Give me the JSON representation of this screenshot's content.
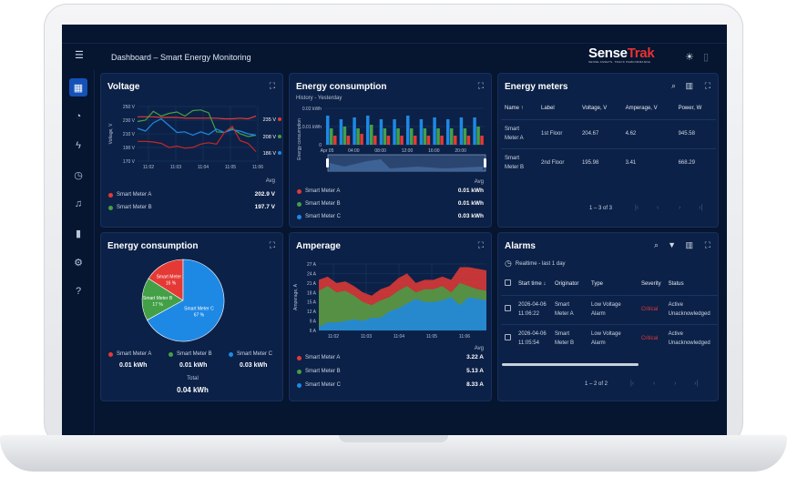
{
  "header": {
    "title": "Dashboard – Smart Energy Monitoring",
    "logo": {
      "part1": "Sense",
      "part2": "Trak",
      "tagline": "SENSE ASSETS. TRACK PERFORMANCE."
    }
  },
  "sidebar": {
    "items": [
      {
        "icon": "menu-icon",
        "glyph": "☰"
      },
      {
        "icon": "dashboard-icon",
        "glyph": "▦",
        "active": true
      },
      {
        "icon": "gauge-icon",
        "glyph": "◔"
      },
      {
        "icon": "bolt-icon",
        "glyph": "ϟ"
      },
      {
        "icon": "pie-icon",
        "glyph": "◷"
      },
      {
        "icon": "bell-icon",
        "glyph": "♫"
      },
      {
        "icon": "bar-chart-icon",
        "glyph": "▮"
      },
      {
        "icon": "settings-icon",
        "glyph": "⚙"
      },
      {
        "icon": "help-icon",
        "glyph": "?"
      }
    ]
  },
  "colors": {
    "a": "#e53935",
    "b": "#43a047",
    "c": "#1e88e5",
    "accent": "#1452b8",
    "bg": "#061530",
    "card": "#0c2147"
  },
  "voltage": {
    "title": "Voltage",
    "avg_label": "Avg",
    "chart_data": {
      "type": "line",
      "ylabel": "Voltage, V",
      "ylim": [
        170,
        250
      ],
      "yticks": [
        "250 V",
        "230 V",
        "210 V",
        "190 V",
        "170 V"
      ],
      "xticks": [
        "11:02",
        "11:03",
        "11:04",
        "11:05",
        "11:06"
      ],
      "series": [
        {
          "color": "#e53935",
          "values": [
            235,
            235,
            235,
            234,
            234,
            234,
            233,
            233,
            233,
            233,
            233,
            232,
            232,
            233,
            232,
            236
          ]
        },
        {
          "color": "#43a047",
          "values": [
            228,
            230,
            243,
            236,
            240,
            242,
            236,
            244,
            245,
            241,
            213,
            212,
            218,
            210,
            206,
            208
          ]
        },
        {
          "color": "#1e88e5",
          "values": [
            218,
            214,
            226,
            232,
            222,
            212,
            213,
            208,
            213,
            209,
            217,
            212,
            216,
            214,
            210,
            208
          ]
        },
        {
          "color": "#c62828",
          "values": [
            199,
            199,
            198,
            196,
            190,
            192,
            189,
            190,
            195,
            197,
            195,
            212,
            221,
            200,
            196,
            184
          ]
        }
      ],
      "end_labels": [
        "235 V",
        "208 V",
        "186 V"
      ]
    },
    "legend": [
      {
        "name": "Smart Meter A",
        "avg": "202.9 V"
      },
      {
        "name": "Smart Meter B",
        "avg": "197.7 V"
      }
    ]
  },
  "energy_history": {
    "title": "Energy consumption",
    "subtitle": "History - Yesterday",
    "avg_label": "Avg",
    "chart_data": {
      "type": "bar",
      "ylabel": "Energy consumption",
      "ylim": [
        0,
        0.02
      ],
      "yticks": [
        "0.02 kWh",
        "0.01 kWh",
        "0"
      ],
      "xticks": [
        "Apr 05",
        "04:00",
        "08:00",
        "12:00",
        "16:00",
        "20:00"
      ],
      "series": [
        {
          "name": "Smart Meter C",
          "values": [
            0.016,
            0.014,
            0.015,
            0.016,
            0.014,
            0.014,
            0.016,
            0.014,
            0.015,
            0.014,
            0.015,
            0.015
          ]
        },
        {
          "name": "Smart Meter B",
          "values": [
            0.009,
            0.01,
            0.009,
            0.011,
            0.009,
            0.009,
            0.009,
            0.009,
            0.009,
            0.009,
            0.009,
            0.01
          ]
        },
        {
          "name": "Smart Meter A",
          "values": [
            0.005,
            0.005,
            0.006,
            0.005,
            0.005,
            0.005,
            0.005,
            0.005,
            0.005,
            0.005,
            0.005,
            0.005
          ]
        }
      ]
    },
    "legend": [
      {
        "name": "Smart Meter A",
        "avg": "0.01 kWh"
      },
      {
        "name": "Smart Meter B",
        "avg": "0.01 kWh"
      },
      {
        "name": "Smart Meter C",
        "avg": "0.03 kWh"
      }
    ]
  },
  "meters": {
    "title": "Energy meters",
    "columns": [
      "Name ↑",
      "Label",
      "Voltage, V",
      "Amperage, V",
      "Power, W"
    ],
    "rows": [
      [
        "Smart Meter A",
        "1st Floor",
        "204.67",
        "4.62",
        "945.58"
      ],
      [
        "Smart Meter B",
        "2nd Floor",
        "195.98",
        "3.41",
        "668.29"
      ]
    ],
    "pagination": "1 – 3 of 3"
  },
  "pie": {
    "title": "Energy consumption",
    "total_label": "Total",
    "total": "0.04 kWh",
    "chart_data": {
      "type": "pie",
      "slices": [
        {
          "name": "Smart Meter A",
          "percent": 16,
          "label": "16 %",
          "value": "0.01 kWh",
          "color": "#e53935"
        },
        {
          "name": "Smart Meter B",
          "percent": 17,
          "label": "17 %",
          "value": "0.01 kWh",
          "color": "#43a047"
        },
        {
          "name": "Smart Meter C",
          "percent": 67,
          "label": "67 %",
          "value": "0.03 kWh",
          "color": "#1e88e5"
        }
      ]
    }
  },
  "amperage": {
    "title": "Amperage",
    "avg_label": "Avg",
    "chart_data": {
      "type": "area",
      "stacked": true,
      "ylabel": "Amperage, A",
      "ylim": [
        6,
        27
      ],
      "yticks": [
        "27 A",
        "24 A",
        "21 A",
        "18 A",
        "15 A",
        "12 A",
        "9 A",
        "6 A"
      ],
      "xticks": [
        "11:02",
        "11:03",
        "11:04",
        "11:05",
        "11:06"
      ],
      "series": [
        {
          "name": "Smart Meter C",
          "color": "#1e88e5",
          "values": [
            7,
            8.5,
            8.5,
            9,
            9.5,
            9,
            10,
            10,
            12,
            13,
            14.5,
            16,
            15,
            15,
            15.5,
            16.5,
            14,
            16.5,
            16,
            15.5
          ]
        },
        {
          "name": "Smart Meter B",
          "color": "#43a047",
          "values": [
            11.5,
            11.5,
            9.5,
            9.5,
            7.5,
            6,
            4,
            5.5,
            4.5,
            5.5,
            5.5,
            2,
            4,
            4,
            4.5,
            1.5,
            7,
            3.5,
            3,
            3
          ]
        },
        {
          "name": "Smart Meter A",
          "color": "#e53935",
          "values": [
            3.5,
            3,
            3,
            3,
            3,
            3,
            3,
            3.5,
            3.5,
            4,
            4,
            3,
            3,
            3,
            3,
            4,
            5,
            6,
            6.5,
            6.5
          ]
        }
      ]
    },
    "legend": [
      {
        "name": "Smart Meter A",
        "avg": "3.22 A"
      },
      {
        "name": "Smart Meter B",
        "avg": "5.13 A"
      },
      {
        "name": "Smart Meter C",
        "avg": "8.33 A"
      }
    ]
  },
  "alarms": {
    "title": "Alarms",
    "timewindow": "Realtime - last 1 day",
    "columns": [
      "Start time ↓",
      "Originator",
      "Type",
      "Severity",
      "Status"
    ],
    "rows": [
      [
        "2026-04-06 11:06:22",
        "Smart Meter A",
        "Low Voltage Alarm",
        "Critical",
        "Active Unacknowledged"
      ],
      [
        "2026-04-06 11:05:54",
        "Smart Meter B",
        "Low Voltage Alarm",
        "Critical",
        "Active Unacknowledged"
      ]
    ],
    "pagination": "1 – 2 of 2"
  }
}
